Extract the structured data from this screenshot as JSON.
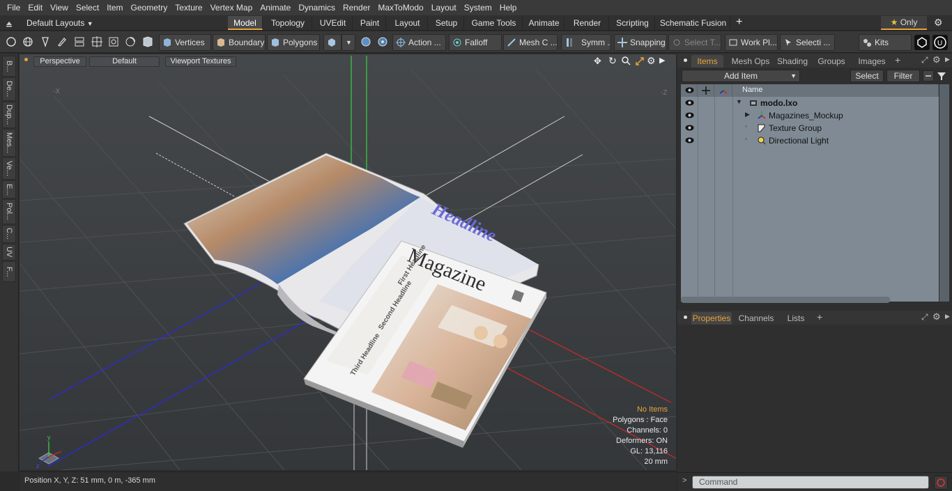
{
  "menu": [
    "File",
    "Edit",
    "View",
    "Select",
    "Item",
    "Geometry",
    "Texture",
    "Vertex Map",
    "Animate",
    "Dynamics",
    "Render",
    "MaxToModo",
    "Layout",
    "System",
    "Help"
  ],
  "layouts": {
    "preset_label": "Default Layouts",
    "tabs": [
      {
        "label": "Model",
        "active": true
      },
      {
        "label": "Topology",
        "active": false
      },
      {
        "label": "UVEdit",
        "active": false
      },
      {
        "label": "Paint",
        "active": false
      },
      {
        "label": "Layout",
        "active": false
      },
      {
        "label": "Setup",
        "active": false
      },
      {
        "label": "Game Tools",
        "active": false
      },
      {
        "label": "Animate",
        "active": false
      },
      {
        "label": "Render",
        "active": false
      },
      {
        "label": "Scripting",
        "active": false
      },
      {
        "label": "Schematic Fusion",
        "active": false
      }
    ],
    "only_label": "Only"
  },
  "toolbar": {
    "vertices": "Vertices",
    "boundary": "Boundary",
    "polygons": "Polygons",
    "action": "Action",
    "falloff": "Falloff",
    "mesh": "Mesh C ...",
    "symm": "Symm ...",
    "snapping": "Snapping",
    "select_t": "Select T...",
    "work_pl": "Work Pl...",
    "selecti": "Selecti ...",
    "kits": "Kits"
  },
  "left_tabs": [
    "B...",
    "De...",
    "Dup...",
    "Mes...",
    "Ve...",
    "E...",
    "Pol...",
    "C...",
    "UV",
    "F..."
  ],
  "viewport": {
    "perspective": "Perspective",
    "default": "Default",
    "textures": "Viewport Textures",
    "hud": {
      "no_items": "No Items",
      "polygons": "Polygons : Face",
      "channels": "Channels: 0",
      "deformers": "Deformers: ON",
      "gl": "GL: 13,116",
      "scale": "20 mm"
    },
    "magazine_title": "Magazine",
    "headlines": [
      "First Headline",
      "Second Headline",
      "Third Headline"
    ],
    "back_headline": "Headline"
  },
  "status": "Position X, Y, Z:   51 mm, 0 m, -365 mm",
  "items_panel": {
    "tabs": [
      {
        "label": "Items",
        "active": true
      },
      {
        "label": "Mesh Ops",
        "active": false
      },
      {
        "label": "Shading",
        "active": false
      },
      {
        "label": "Groups",
        "active": false
      },
      {
        "label": "Images",
        "active": false
      }
    ],
    "add_item": "Add Item",
    "select": "Select",
    "filter": "Filter",
    "name_col": "Name",
    "tree": [
      {
        "label": "modo.lxo",
        "indent": 0
      },
      {
        "label": "Magazines_Mockup",
        "indent": 1
      },
      {
        "label": "Texture Group",
        "indent": 1
      },
      {
        "label": "Directional Light",
        "indent": 1
      }
    ]
  },
  "properties_panel": {
    "tabs": [
      {
        "label": "Properties",
        "active": true
      },
      {
        "label": "Channels",
        "active": false
      },
      {
        "label": "Lists",
        "active": false
      }
    ]
  },
  "command": {
    "placeholder": "Command"
  },
  "colors": {
    "accent": "#e8a33a",
    "bg": "#2b2b2b",
    "items_bg": "#7f8a94"
  }
}
